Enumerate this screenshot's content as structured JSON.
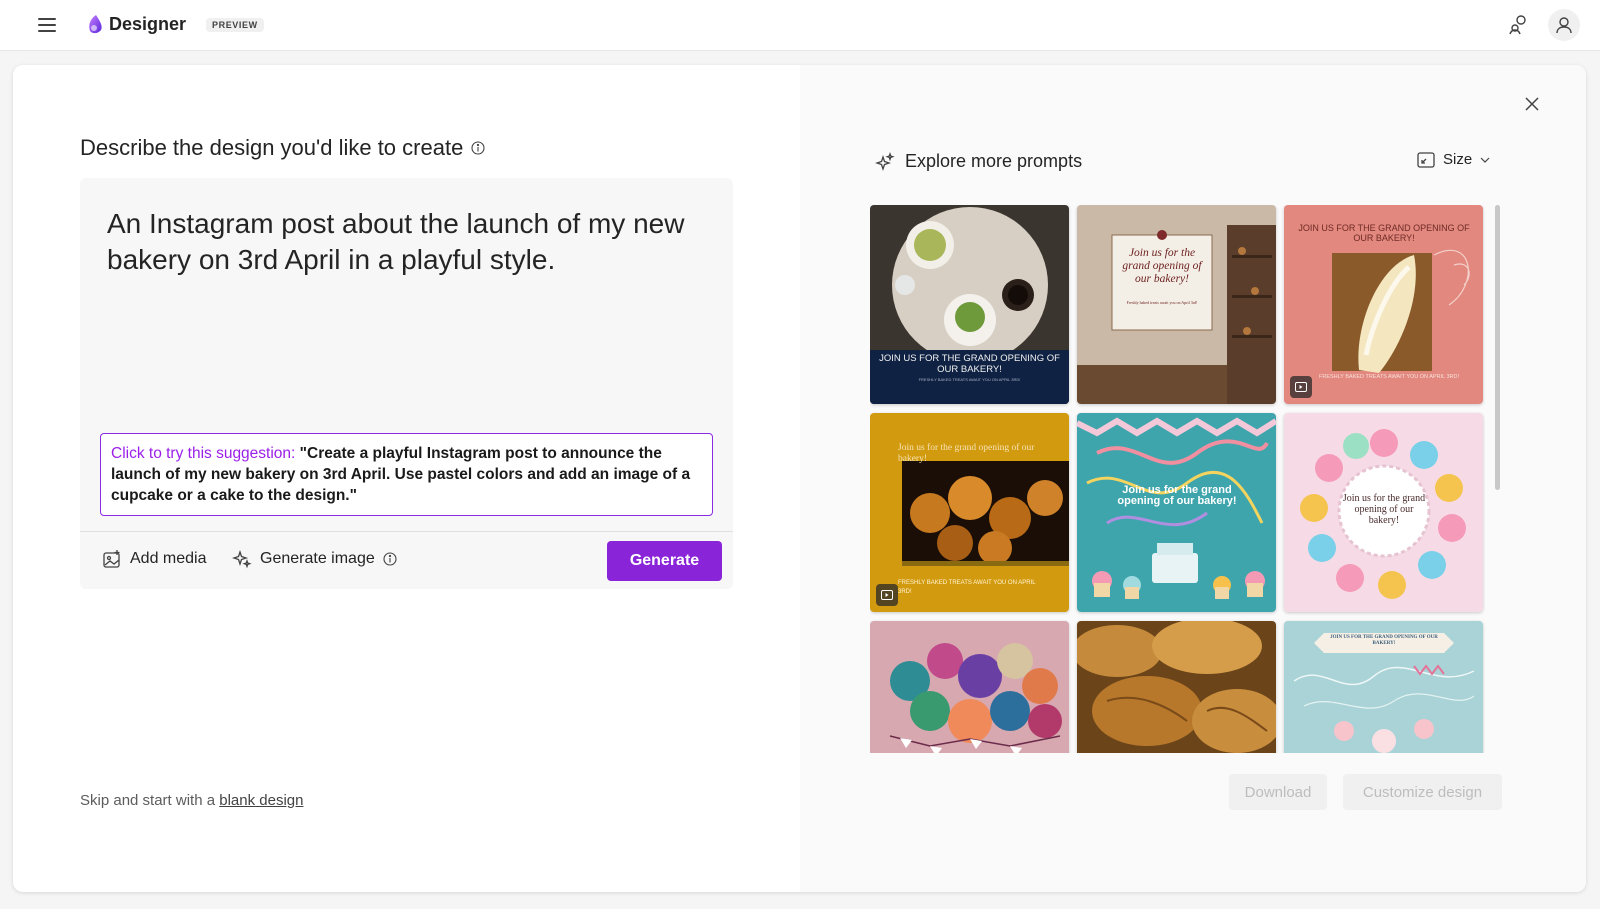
{
  "header": {
    "app_name": "Designer",
    "badge": "PREVIEW"
  },
  "prompt": {
    "heading": "Describe the design you'd like to create",
    "text": "An Instagram post about the launch of my new bakery on 3rd April in a playful style.",
    "suggestion_lead": "Click to try this suggestion: ",
    "suggestion_body": "\"Create a playful Instagram post to announce the launch of my new bakery on 3rd April. Use pastel colors and add an image of a cupcake or a cake to the design.\"",
    "add_media": "Add media",
    "generate_image": "Generate image",
    "generate_button": "Generate"
  },
  "skip": {
    "prefix": "Skip and start with a ",
    "link": "blank design"
  },
  "explore": {
    "title": "Explore more prompts",
    "size_label": "Size"
  },
  "gallery": [
    {
      "text": "JOIN US FOR THE GRAND OPENING OF OUR BAKERY!",
      "subtext": "FRESHLY BAKED TREATS AWAIT YOU ON APRIL 3RD!",
      "video": false
    },
    {
      "text": "Join us for the grand opening of our bakery!",
      "subtext": "Freshly baked treats await you on April 3rd!",
      "video": false
    },
    {
      "text": "JOIN US FOR THE GRAND OPENING OF OUR BAKERY!",
      "subtext": "FRESHLY BAKED TREATS AWAIT YOU ON APRIL 3RD!",
      "video": true
    },
    {
      "text": "Join us for the grand opening of our bakery!",
      "subtext": "FRESHLY BAKED TREATS AWAIT YOU ON APRIL 3RD!",
      "video": true
    },
    {
      "text": "Join us for the grand opening of our bakery!",
      "subtext": "",
      "video": false
    },
    {
      "text": "Join us for the grand opening of our bakery!",
      "subtext": "",
      "video": false
    },
    {
      "text": "",
      "subtext": "",
      "video": false
    },
    {
      "text": "",
      "subtext": "",
      "video": false
    },
    {
      "text": "JOIN US FOR THE GRAND OPENING OF OUR BAKERY!",
      "subtext": "",
      "video": false
    }
  ],
  "actions": {
    "download": "Download",
    "customize": "Customize design"
  },
  "colors": {
    "accent": "#8a24d9",
    "suggestion_border": "#8a2be2"
  }
}
